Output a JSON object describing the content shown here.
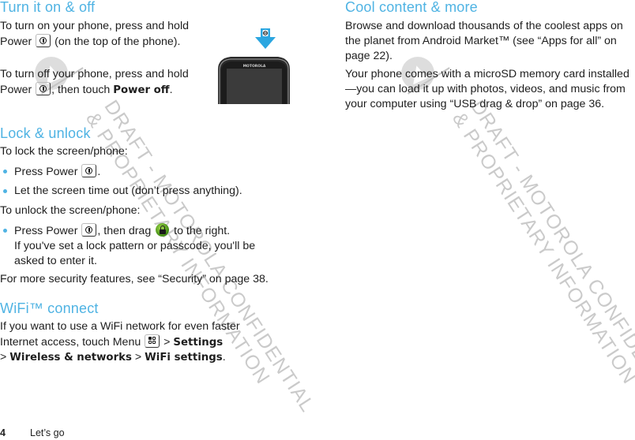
{
  "left": {
    "section1": {
      "title": "Turn it on & off",
      "p1_a": "To turn on your phone, press and hold Power",
      "p1_b": "(on the top of the phone).",
      "p2_a": "To turn off your phone, press and hold Power",
      "p2_b": ", then touch",
      "p2_bold": "Power off",
      "p2_end": "."
    },
    "section2": {
      "title": "Lock & unlock",
      "lock_intro": "To lock the screen/phone:",
      "lock_bullets": [
        {
          "a": "Press Power",
          "b": "."
        },
        {
          "a": "Let the screen time out (don’t press anything)."
        }
      ],
      "unlock_intro": "To unlock the screen/phone:",
      "unlock_bullet": {
        "a": "Press Power",
        "b": ", then drag",
        "c": "to the right.",
        "d": "If you've set a lock pattern or passcode, you'll be asked to enter it."
      },
      "more": "For more security features, see “Security” on page 38."
    },
    "section3": {
      "title": "WiFi™ connect",
      "p_a": "If you want to use a WiFi network for even faster Internet access, touch Menu",
      "sep": ">",
      "path": [
        "Settings",
        "Wireless & networks",
        "WiFi settings"
      ],
      "end": "."
    }
  },
  "right": {
    "section1": {
      "title": "Cool content & more",
      "p1": "Browse and download thousands of the coolest apps on the planet from Android Market™ (see “Apps for all” on page 22).",
      "p2": "Your phone comes with a microSD memory card installed—you can load it up with photos, videos, and music from your computer using “USB drag & drop” on page 36."
    }
  },
  "illustration": {
    "brand": "MOTOROLA",
    "arrow_color": "#2ba6e0"
  },
  "footer": {
    "page_number": "4",
    "section": "Let’s go"
  },
  "watermark": {
    "line1": "DRAFT - MOTOROLA CONFIDENTIAL",
    "line2": "& PROPRIETARY INFORMATION"
  },
  "colors": {
    "heading": "#4fb3e3",
    "bullet": "#4fb3e3",
    "lock_icon": "#5aa51e"
  }
}
